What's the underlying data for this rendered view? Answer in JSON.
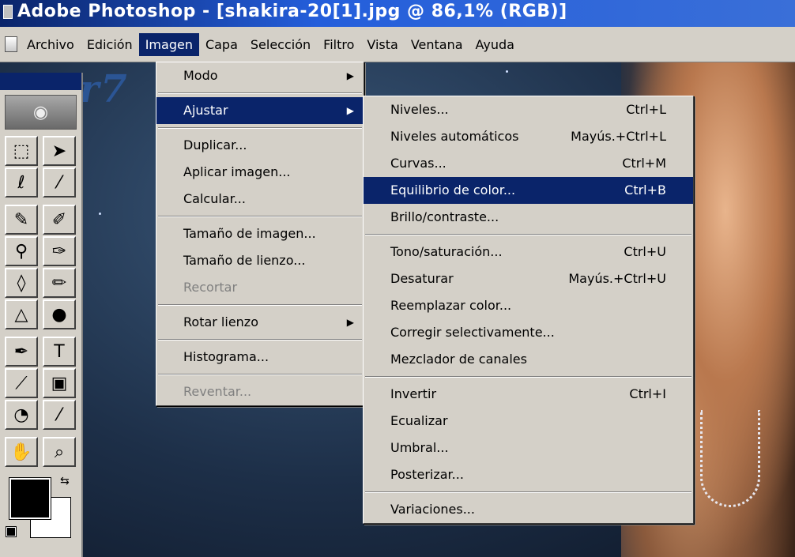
{
  "window": {
    "title": "Adobe Photoshop - [shakira-20[1].jpg @ 86,1% (RGB)]"
  },
  "menubar": {
    "items": [
      {
        "label": "Archivo"
      },
      {
        "label": "Edición"
      },
      {
        "label": "Imagen"
      },
      {
        "label": "Capa"
      },
      {
        "label": "Selección"
      },
      {
        "label": "Filtro"
      },
      {
        "label": "Vista"
      },
      {
        "label": "Ventana"
      },
      {
        "label": "Ayuda"
      }
    ],
    "active": "Imagen"
  },
  "imagen_menu": {
    "items": [
      {
        "label": "Modo",
        "submenu": true
      },
      {
        "label": "Ajustar",
        "submenu": true,
        "active": true
      },
      {
        "label": "Duplicar..."
      },
      {
        "label": "Aplicar imagen..."
      },
      {
        "label": "Calcular..."
      },
      {
        "label": "Tamaño de imagen..."
      },
      {
        "label": "Tamaño de lienzo..."
      },
      {
        "label": "Recortar",
        "disabled": true
      },
      {
        "label": "Rotar lienzo",
        "submenu": true
      },
      {
        "label": "Histograma..."
      },
      {
        "label": "Reventar...",
        "disabled": true
      }
    ]
  },
  "ajustar_menu": {
    "items": [
      {
        "label": "Niveles...",
        "shortcut": "Ctrl+L"
      },
      {
        "label": "Niveles automáticos",
        "shortcut": "Mayús.+Ctrl+L"
      },
      {
        "label": "Curvas...",
        "shortcut": "Ctrl+M"
      },
      {
        "label": "Equilibrio de color...",
        "shortcut": "Ctrl+B",
        "active": true
      },
      {
        "label": "Brillo/contraste..."
      },
      {
        "label": "Tono/saturación...",
        "shortcut": "Ctrl+U"
      },
      {
        "label": "Desaturar",
        "shortcut": "Mayús.+Ctrl+U"
      },
      {
        "label": "Reemplazar color..."
      },
      {
        "label": "Corregir selectivamente..."
      },
      {
        "label": "Mezclador de canales"
      },
      {
        "label": "Invertir",
        "shortcut": "Ctrl+I"
      },
      {
        "label": "Ecualizar"
      },
      {
        "label": "Umbral..."
      },
      {
        "label": "Posterizar..."
      },
      {
        "label": "Variaciones..."
      }
    ]
  },
  "colors": {
    "highlight": "#0a246a",
    "menu_bg": "#d4d0c8",
    "foreground_swatch": "#000000",
    "background_swatch": "#ffffff"
  },
  "toolbox": {
    "tools": [
      "marquee-tool",
      "move-tool",
      "lasso-tool",
      "magic-wand-tool",
      "airbrush-tool",
      "paintbrush-tool",
      "rubber-stamp-tool",
      "history-brush-tool",
      "eraser-tool",
      "pencil-tool",
      "blur-tool",
      "burn-tool",
      "pen-tool",
      "type-tool",
      "measure-tool",
      "gradient-tool",
      "paint-bucket-tool",
      "eyedropper-tool",
      "hand-tool",
      "zoom-tool"
    ]
  }
}
